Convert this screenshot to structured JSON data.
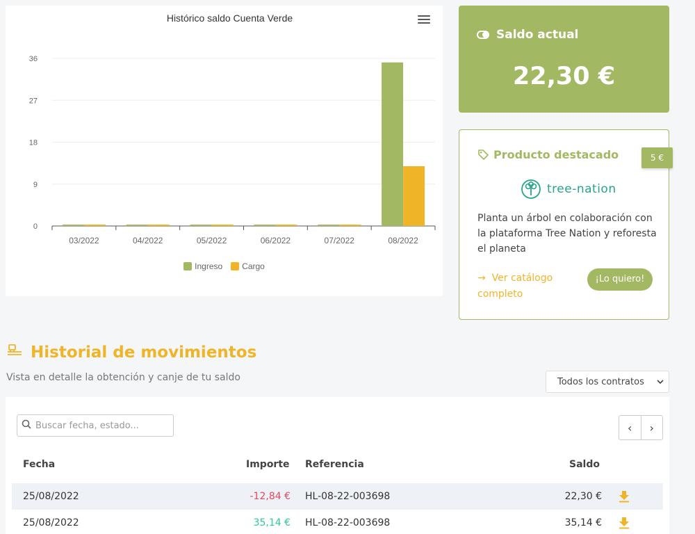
{
  "chart_data": {
    "type": "bar",
    "title": "Histórico saldo Cuenta Verde",
    "categories": [
      "03/2022",
      "04/2022",
      "05/2022",
      "06/2022",
      "07/2022",
      "08/2022"
    ],
    "series": [
      {
        "name": "Ingreso",
        "color": "#a3b862",
        "values": [
          0,
          0,
          0,
          0,
          0,
          35.14
        ]
      },
      {
        "name": "Cargo",
        "color": "#f0b429",
        "values": [
          0,
          0,
          0,
          0,
          0,
          12.84
        ]
      }
    ],
    "yticks": [
      "0",
      "9",
      "18",
      "27",
      "36"
    ],
    "ylim": [
      0,
      36
    ],
    "grid": true,
    "legend_position": "bottom"
  },
  "saldo": {
    "label": "Saldo actual",
    "value": "22,30 €",
    "icon": "toggle-icon"
  },
  "producto": {
    "title": "Producto destacado",
    "price": "5 €",
    "brand": "tree-nation",
    "description": "Planta un árbol en colaboración con la plataforma Tree Nation y reforesta el planeta",
    "link_label": "Ver catálogo completo",
    "cta_label": "¡Lo quiero!"
  },
  "historial": {
    "title": "Historial de movimientos",
    "subtitle": "Vista en detalle la obtención y canje de tu saldo",
    "contract_select": "Todos los contratos",
    "search_placeholder": "Buscar fecha, estado...",
    "columns": {
      "fecha": "Fecha",
      "importe": "Importe",
      "referencia": "Referencia",
      "saldo": "Saldo"
    },
    "rows": [
      {
        "fecha": "25/08/2022",
        "importe": "-12,84 €",
        "referencia": "HL-08-22-003698",
        "saldo": "22,30 €"
      },
      {
        "fecha": "25/08/2022",
        "importe": "35,14 €",
        "referencia": "HL-08-22-003698",
        "saldo": "35,14 €"
      }
    ]
  },
  "colors": {
    "green": "#a3b862",
    "orange": "#f0b429",
    "negative": "#e8495f",
    "positive": "#2ecc8f"
  }
}
